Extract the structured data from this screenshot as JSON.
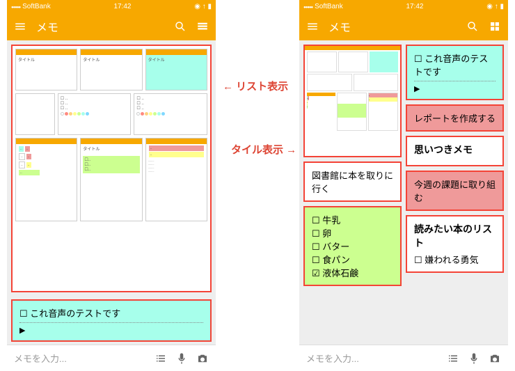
{
  "status": {
    "carrier": "SoftBank",
    "time": "17:42"
  },
  "appbar": {
    "title": "メモ"
  },
  "labels": {
    "list_view": "← リスト表示",
    "tile_view": "タイル表示 →"
  },
  "notes": {
    "voice_test": "これ音声のテストです",
    "create_report": "レポートを作成する",
    "idea_memo": "思いつきメモ",
    "weekly_task": "今週の課題に取り組む",
    "library": "図書館に本を取りに行く",
    "reading_list_title": "読みたい本のリスト",
    "reading_list_item": "嫌われる勇気",
    "shopping": {
      "items": [
        "牛乳",
        "卵",
        "バター",
        "食パン"
      ],
      "done": "液体石鹸"
    }
  },
  "bottom": {
    "placeholder": "メモを入力..."
  },
  "mini": {
    "title_label": "タイトル"
  }
}
